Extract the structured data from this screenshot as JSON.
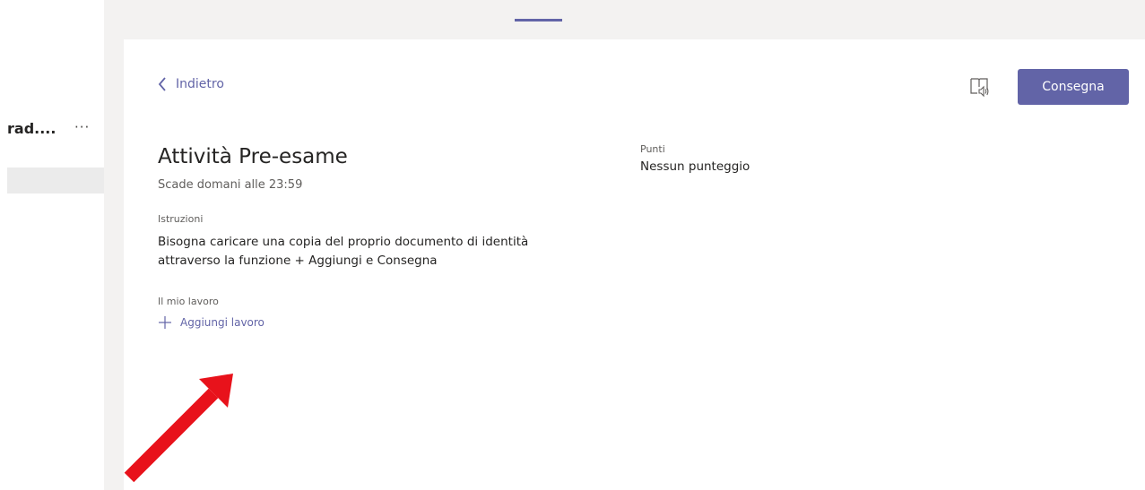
{
  "sidebar": {
    "team_name": "rad....",
    "more_label": "···"
  },
  "header": {
    "back_label": "Indietro",
    "reader_icon": "immersive-reader-icon",
    "turn_in_label": "Consegna"
  },
  "assignment": {
    "title": "Attività Pre-esame",
    "due": "Scade domani alle 23:59",
    "instructions_label": "Istruzioni",
    "instructions_text": "Bisogna caricare una copia del proprio documento di identità attraverso la funzione + Aggiungi e Consegna",
    "my_work_label": "Il mio lavoro",
    "add_work_label": "Aggiungi lavoro"
  },
  "points": {
    "label": "Punti",
    "value": "Nessun punteggio"
  },
  "colors": {
    "accent": "#6264a7",
    "annotation_arrow": "#e8121b"
  }
}
